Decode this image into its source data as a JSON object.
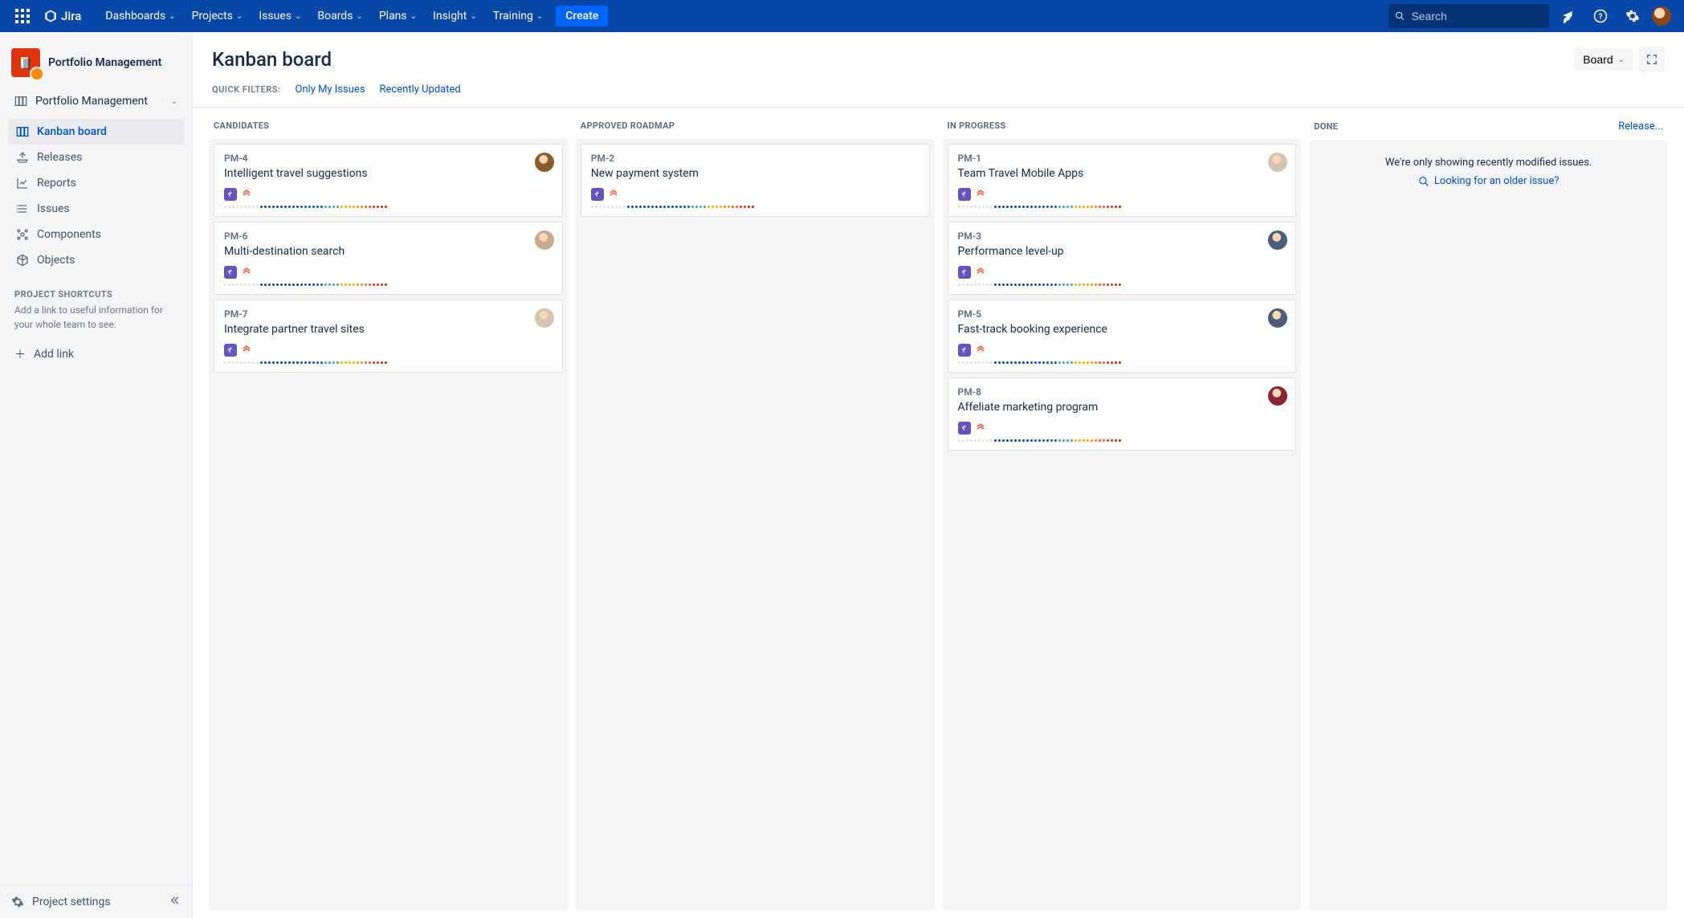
{
  "topnav": {
    "product": "Jira",
    "menu": [
      "Dashboards",
      "Projects",
      "Issues",
      "Boards",
      "Plans",
      "Insight",
      "Training"
    ],
    "create": "Create",
    "search_placeholder": "Search"
  },
  "sidebar": {
    "project_name": "Portfolio Management",
    "collapsible": "Portfolio Management",
    "items": [
      {
        "icon": "board",
        "label": "Kanban board",
        "active": true
      },
      {
        "icon": "ship",
        "label": "Releases"
      },
      {
        "icon": "chart",
        "label": "Reports"
      },
      {
        "icon": "list",
        "label": "Issues"
      },
      {
        "icon": "component",
        "label": "Components"
      },
      {
        "icon": "cube",
        "label": "Objects"
      }
    ],
    "shortcuts_head": "PROJECT SHORTCUTS",
    "shortcuts_desc": "Add a link to useful information for your whole team to see.",
    "add_link": "Add link",
    "settings": "Project settings"
  },
  "main": {
    "title": "Kanban board",
    "board_dd": "Board",
    "filters_label": "QUICK FILTERS:",
    "filters": [
      "Only My Issues",
      "Recently Updated"
    ],
    "release_link": "Release...",
    "columns": [
      {
        "name": "CANDIDATES",
        "cards": [
          {
            "key": "PM-4",
            "title": "Intelligent travel suggestions",
            "avatar": "#8B5A2B"
          },
          {
            "key": "PM-6",
            "title": "Multi-destination search",
            "avatar": "#C9A98E"
          },
          {
            "key": "PM-7",
            "title": "Integrate partner travel sites",
            "avatar": "#D4C5B3"
          }
        ]
      },
      {
        "name": "APPROVED ROADMAP",
        "cards": [
          {
            "key": "PM-2",
            "title": "New payment system",
            "avatar": null
          }
        ]
      },
      {
        "name": "IN PROGRESS",
        "cards": [
          {
            "key": "PM-1",
            "title": "Team Travel Mobile Apps",
            "avatar": "#D4C5B3"
          },
          {
            "key": "PM-3",
            "title": "Performance level-up",
            "avatar": "#4A5D7A"
          },
          {
            "key": "PM-5",
            "title": "Fast-track booking experience",
            "avatar": "#4A5D7A"
          },
          {
            "key": "PM-8",
            "title": "Affeliate marketing program",
            "avatar": "#8B2635"
          }
        ]
      },
      {
        "name": "DONE",
        "cards": [],
        "done": true
      }
    ],
    "done_msg": "We're only showing recently modified issues.",
    "done_link": "Looking for an older issue?"
  },
  "dot_colors": [
    "#DFE1E6",
    "#DFE1E6",
    "#DFE1E6",
    "#DFE1E6",
    "#DFE1E6",
    "#DFE1E6",
    "#DFE1E6",
    "#DFE1E6",
    "#DFE1E6",
    "#0747A6",
    "#0747A6",
    "#0747A6",
    "#0747A6",
    "#0747A6",
    "#0747A6",
    "#0747A6",
    "#0747A6",
    "#0747A6",
    "#0747A6",
    "#0052CC",
    "#0052CC",
    "#0052CC",
    "#0052CC",
    "#0052CC",
    "#0052CC",
    "#36B37E",
    "#36B37E",
    "#36B37E",
    "#36B37E",
    "#FFAB00",
    "#FFAB00",
    "#FFAB00",
    "#FFAB00",
    "#FF8B00",
    "#FF8B00",
    "#FF5630",
    "#FF5630",
    "#DE350B",
    "#DE350B",
    "#BF2600",
    "#BF2600"
  ]
}
